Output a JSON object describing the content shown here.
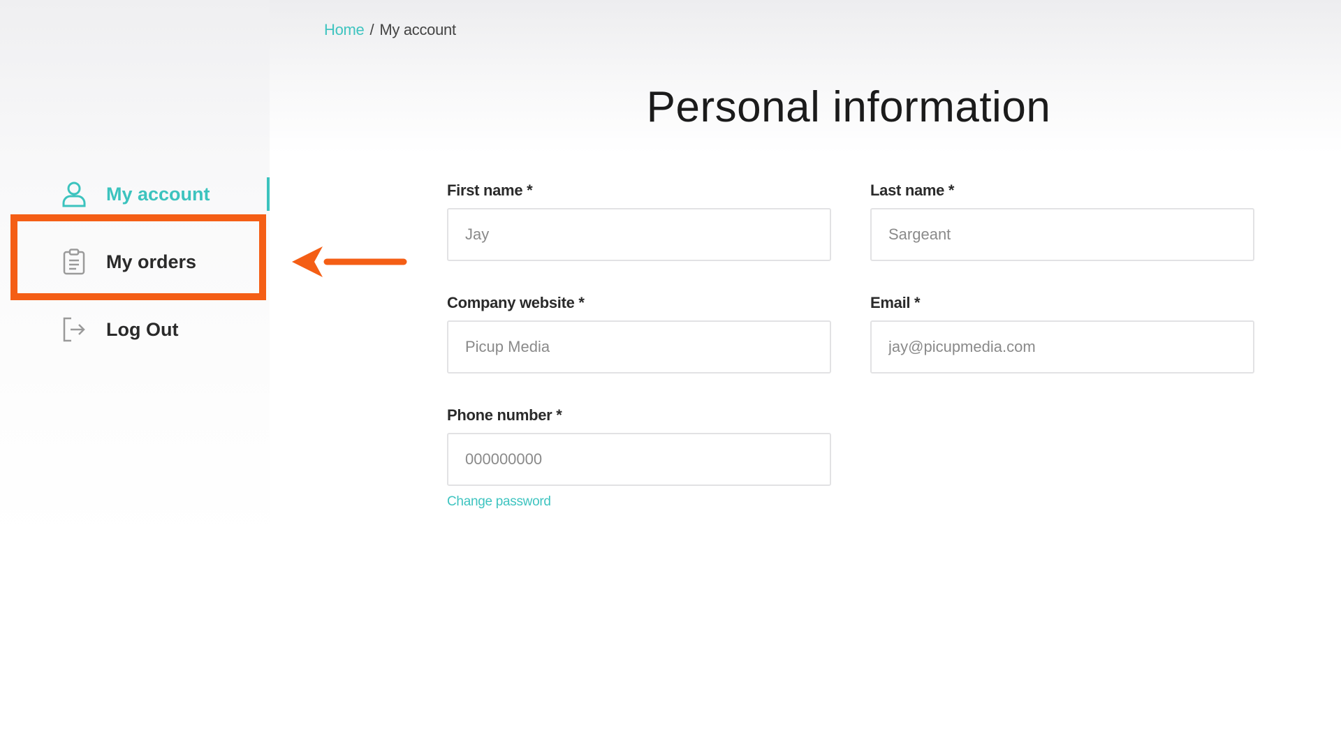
{
  "breadcrumb": {
    "home": "Home",
    "separator": "/",
    "current": "My account"
  },
  "title": "Personal information",
  "sidebar": {
    "items": [
      {
        "label": "My account",
        "icon": "user-icon",
        "active": true
      },
      {
        "label": "My orders",
        "icon": "clipboard-icon",
        "active": false
      },
      {
        "label": "Log Out",
        "icon": "logout-icon",
        "active": false
      }
    ]
  },
  "form": {
    "first_name": {
      "label": "First name *",
      "value": "Jay"
    },
    "last_name": {
      "label": "Last name *",
      "value": "Sargeant"
    },
    "company_website": {
      "label": "Company website *",
      "value": "Picup Media"
    },
    "email": {
      "label": "Email *",
      "value": "jay@picupmedia.com"
    },
    "phone": {
      "label": "Phone number *",
      "value": "000000000"
    },
    "change_password": "Change password"
  },
  "colors": {
    "accent": "#3cc3be",
    "highlight": "#f45e15",
    "text": "#2a2a2a"
  }
}
